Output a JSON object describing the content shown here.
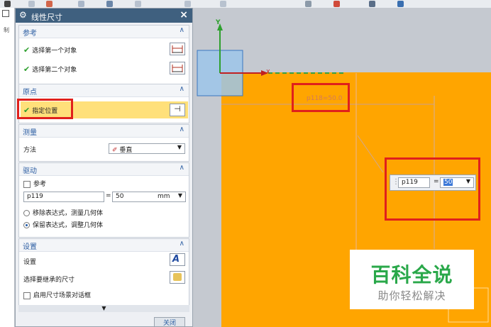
{
  "dialog": {
    "title": "线性尺寸",
    "close_label": "关闭",
    "sections": {
      "reference": {
        "header": "参考",
        "first_object": "选择第一个对象",
        "second_object": "选择第二个对象"
      },
      "origin": {
        "header": "原点",
        "specify_location": "指定位置"
      },
      "measure": {
        "header": "测量",
        "method_label": "方法",
        "method_value": "垂直"
      },
      "drive": {
        "header": "驱动",
        "reference_checkbox": "参考",
        "expression_name": "p119",
        "equals": "=",
        "expression_value": "50",
        "unit": "mm",
        "option_remove": "移除表达式，测量几何体",
        "option_keep": "保留表达式，调整几何体"
      },
      "settings": {
        "header": "设置",
        "settings_label": "设置",
        "inherit_label": "选择要继承的尺寸",
        "enable_dialog": "启用尺寸场景对话框"
      }
    }
  },
  "canvas": {
    "axis_y": "Y",
    "axis_x": "X",
    "dimension_label": "p118=50.0",
    "popup_name": "p119",
    "popup_equals": "=",
    "popup_value": "50"
  },
  "watermark": {
    "title": "百科全说",
    "subtitle": "助你轻松解决"
  },
  "left_strip_label": "制",
  "colors": {
    "orange": "#ffa500",
    "title_bar": "#3f607f",
    "highlight": "#ffe07a",
    "red_box": "#e0201c",
    "check_green": "#2ea02e"
  }
}
